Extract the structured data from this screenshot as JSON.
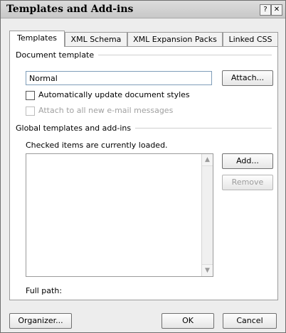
{
  "window": {
    "title": "Templates and Add-ins",
    "help_icon": "help-icon",
    "close_icon": "close-icon"
  },
  "tabs": [
    {
      "label": "Templates",
      "active": true
    },
    {
      "label": "XML Schema"
    },
    {
      "label": "XML Expansion Packs"
    },
    {
      "label": "Linked CSS"
    }
  ],
  "document_template": {
    "label": "Document template",
    "value": "Normal",
    "attach_button": "Attach...",
    "auto_update_label": "Automatically update document styles",
    "attach_email_label": "Attach to all new e-mail messages"
  },
  "global": {
    "label": "Global templates and add-ins",
    "note": "Checked items are currently loaded.",
    "add_button": "Add...",
    "remove_button": "Remove",
    "full_path_label": "Full path:"
  },
  "footer": {
    "organizer_button": "Organizer...",
    "ok_button": "OK",
    "cancel_button": "Cancel"
  }
}
